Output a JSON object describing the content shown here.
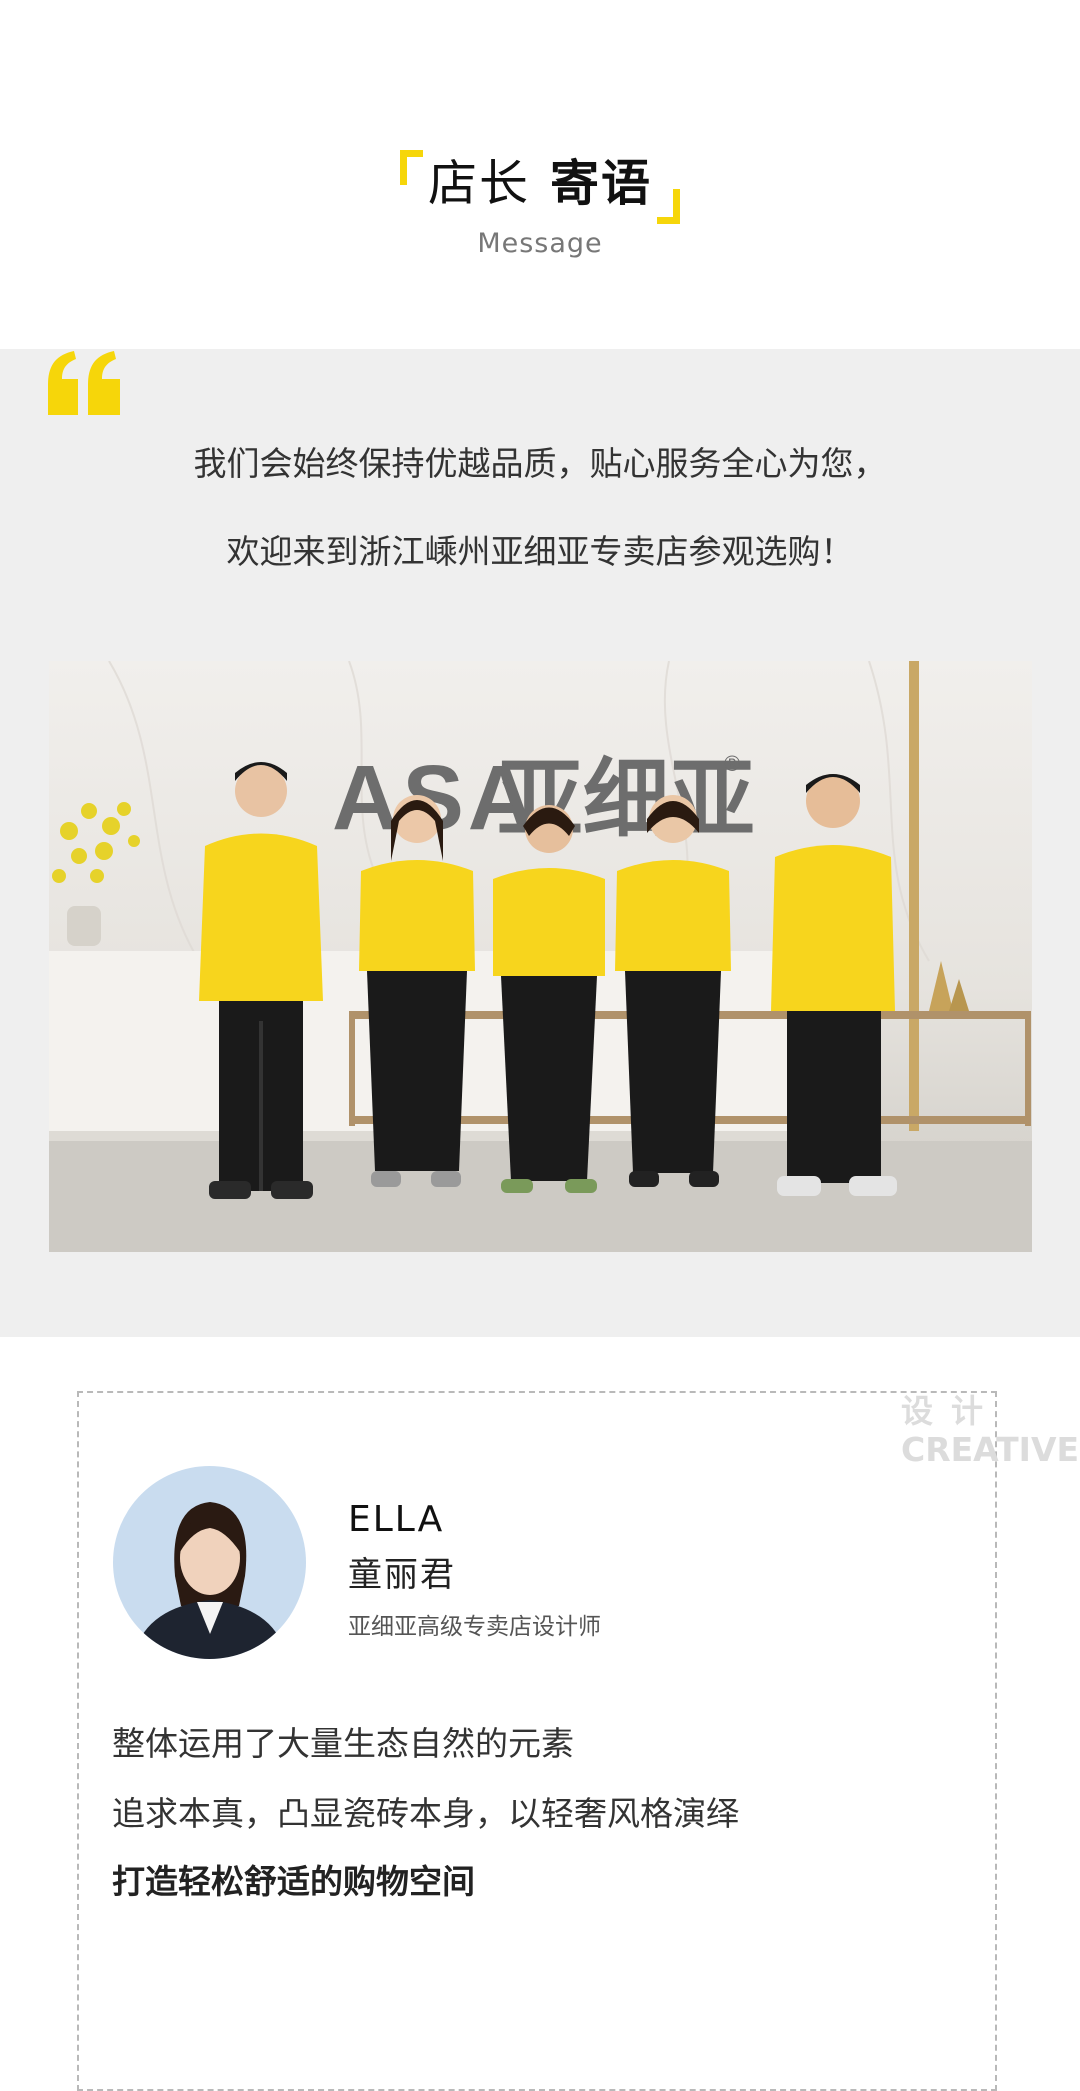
{
  "header": {
    "title_light": "店长",
    "title_bold": "寄语",
    "subtitle": "Message"
  },
  "quote": {
    "line1": "我们会始终保持优越品质，贴心服务全心为您，",
    "line2": "欢迎来到浙江嵊州亚细亚专卖店参观选购！"
  },
  "photo": {
    "brand_latin": "ASA",
    "brand_cn": "亚细亚",
    "registered_mark": "®"
  },
  "profile": {
    "watermark_line1": "设计",
    "watermark_line2": "CREATIVE",
    "name_en": "ELLA",
    "name_cn": "童丽君",
    "role": "亚细亚高级专卖店设计师",
    "desc_line1": "整体运用了大量生态自然的元素",
    "desc_line2": "追求本真，凸显瓷砖本身，以轻奢风格演绎",
    "desc_line3": "打造轻松舒适的购物空间"
  },
  "colors": {
    "accent": "#f6d60a",
    "section_bg": "#efefef",
    "shirt": "#f7d51d",
    "pants": "#1a1a1a"
  },
  "icons": {
    "quote_mark": "quote-mark-icon"
  }
}
